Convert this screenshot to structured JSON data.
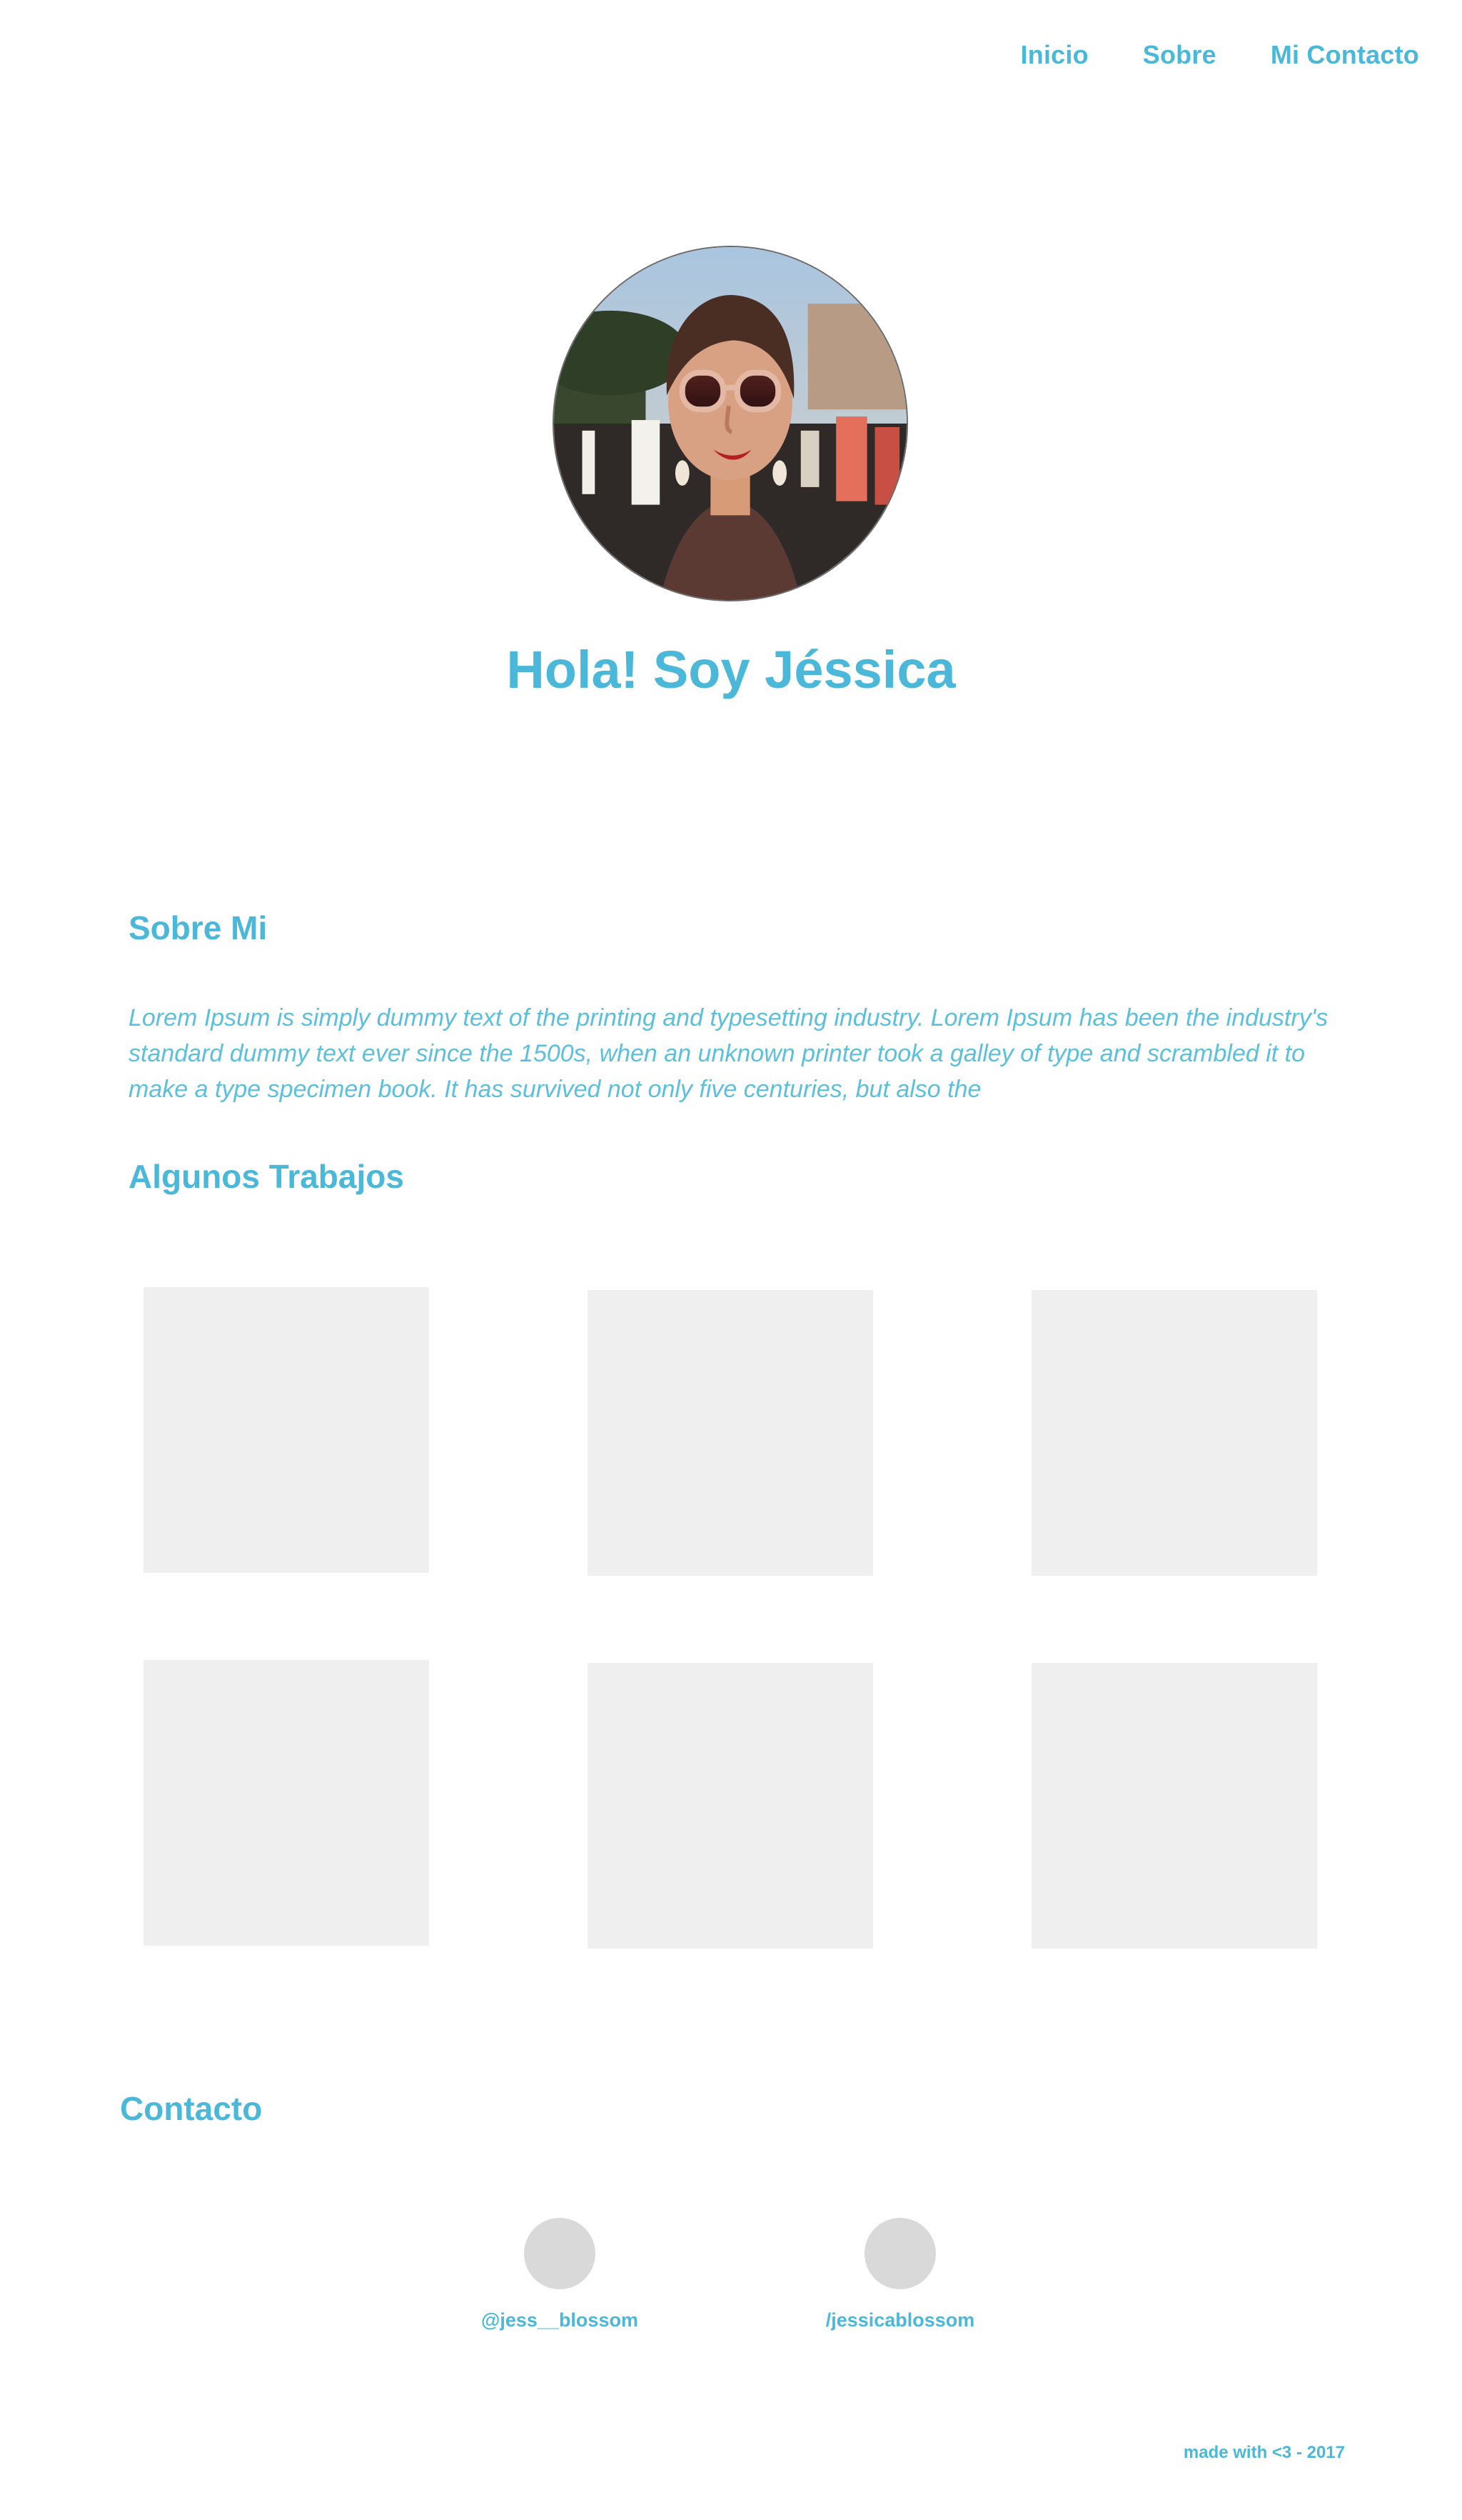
{
  "nav": {
    "items": [
      {
        "label": "Inicio"
      },
      {
        "label": "Sobre"
      },
      {
        "label": "Mi Contacto"
      }
    ]
  },
  "hero": {
    "title": "Hola! Soy Jéssica"
  },
  "about": {
    "title": "Sobre Mi",
    "text": "Lorem Ipsum is simply dummy text of the printing and typesetting industry. Lorem Ipsum has been the industry's standard dummy text ever since the 1500s, when an unknown printer took a galley of type and scrambled it to make a type specimen book. It has survived not only five centuries, but also the"
  },
  "work": {
    "title": "Algunos Trabajos"
  },
  "contact": {
    "title": "Contacto",
    "items": [
      {
        "label": "@jess__blossom",
        "icon": "instagram-icon"
      },
      {
        "label": "/jessicablossom",
        "icon": "facebook-icon"
      }
    ]
  },
  "footer": {
    "note": "made with <3 - 2017"
  },
  "colors": {
    "accent": "#4bb8d9",
    "tile": "#efefef",
    "contact_circle": "#d9d9d9"
  }
}
